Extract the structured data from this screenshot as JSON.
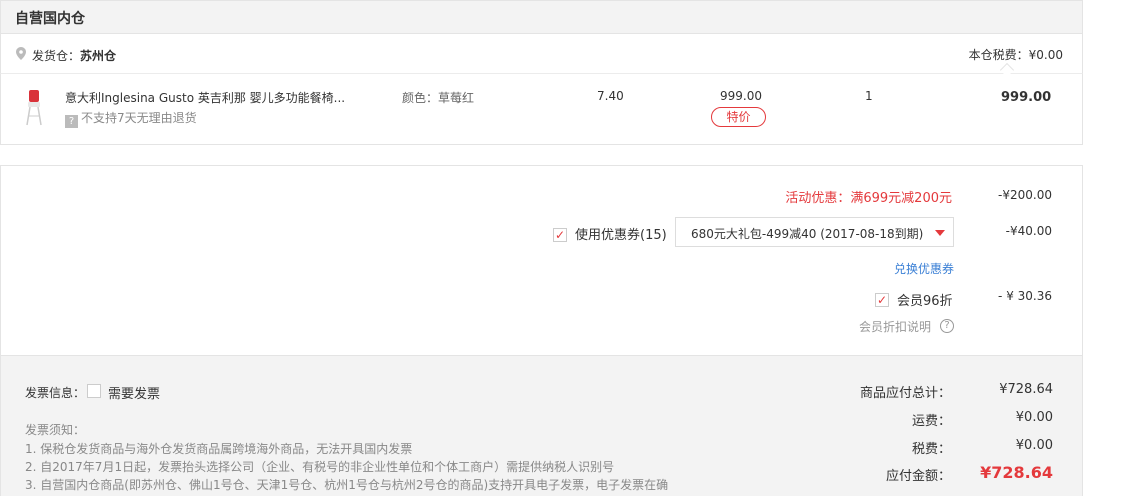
{
  "warehouse": {
    "title": "自营国内仓",
    "ship_from_label": "发货仓：",
    "ship_from_value": "苏州仓",
    "tax_label": "本仓税费：¥0.00"
  },
  "product": {
    "name": "意大利Inglesina Gusto 英吉利那 婴儿多功能餐椅...",
    "return_note": "不支持7天无理由退货",
    "return_icon": "?",
    "color": "颜色：草莓红",
    "tax": "7.40",
    "price": "999.00",
    "badge": "特价",
    "qty": "1",
    "subtotal": "999.00"
  },
  "discounts": {
    "promo_text": "活动优惠：满699元减200元",
    "promo_amount": "-¥200.00",
    "coupon_check": "✓",
    "coupon_label": "使用优惠券(15)",
    "coupon_selected": "680元大礼包-499减40 (2017-08-18到期)",
    "coupon_amount": "-¥40.00",
    "exchange_link": "兑换优惠券",
    "member_check": "✓",
    "member_label": "会员96折",
    "member_amount": "- ¥ 30.36",
    "member_explain": "会员折扣说明",
    "help_icon": "?"
  },
  "invoice": {
    "label": "发票信息：",
    "need_label": "需要发票",
    "notice_title": "发票须知：",
    "notices": [
      "1. 保税仓发货商品与海外仓发货商品属跨境海外商品，无法开具国内发票",
      "2. 自2017年7月1日起，发票抬头选择公司（企业、有税号的非企业性单位和个体工商户）需提供纳税人识别号",
      "3. 自营国内仓商品(即苏州仓、佛山1号仓、天津1号仓、杭州1号仓与杭州2号仓的商品)支持开具电子发票，电子发票在确"
    ]
  },
  "summary": {
    "goods_total_label": "商品应付总计：",
    "goods_total_value": "¥728.64",
    "shipping_label": "运费：",
    "shipping_value": "¥0.00",
    "tax_label": "税费：",
    "tax_value": "¥0.00",
    "payable_label": "应付金额：",
    "payable_value": "¥728.64"
  },
  "colors": {
    "accent": "#e4393c",
    "link": "#3a7fd5"
  }
}
